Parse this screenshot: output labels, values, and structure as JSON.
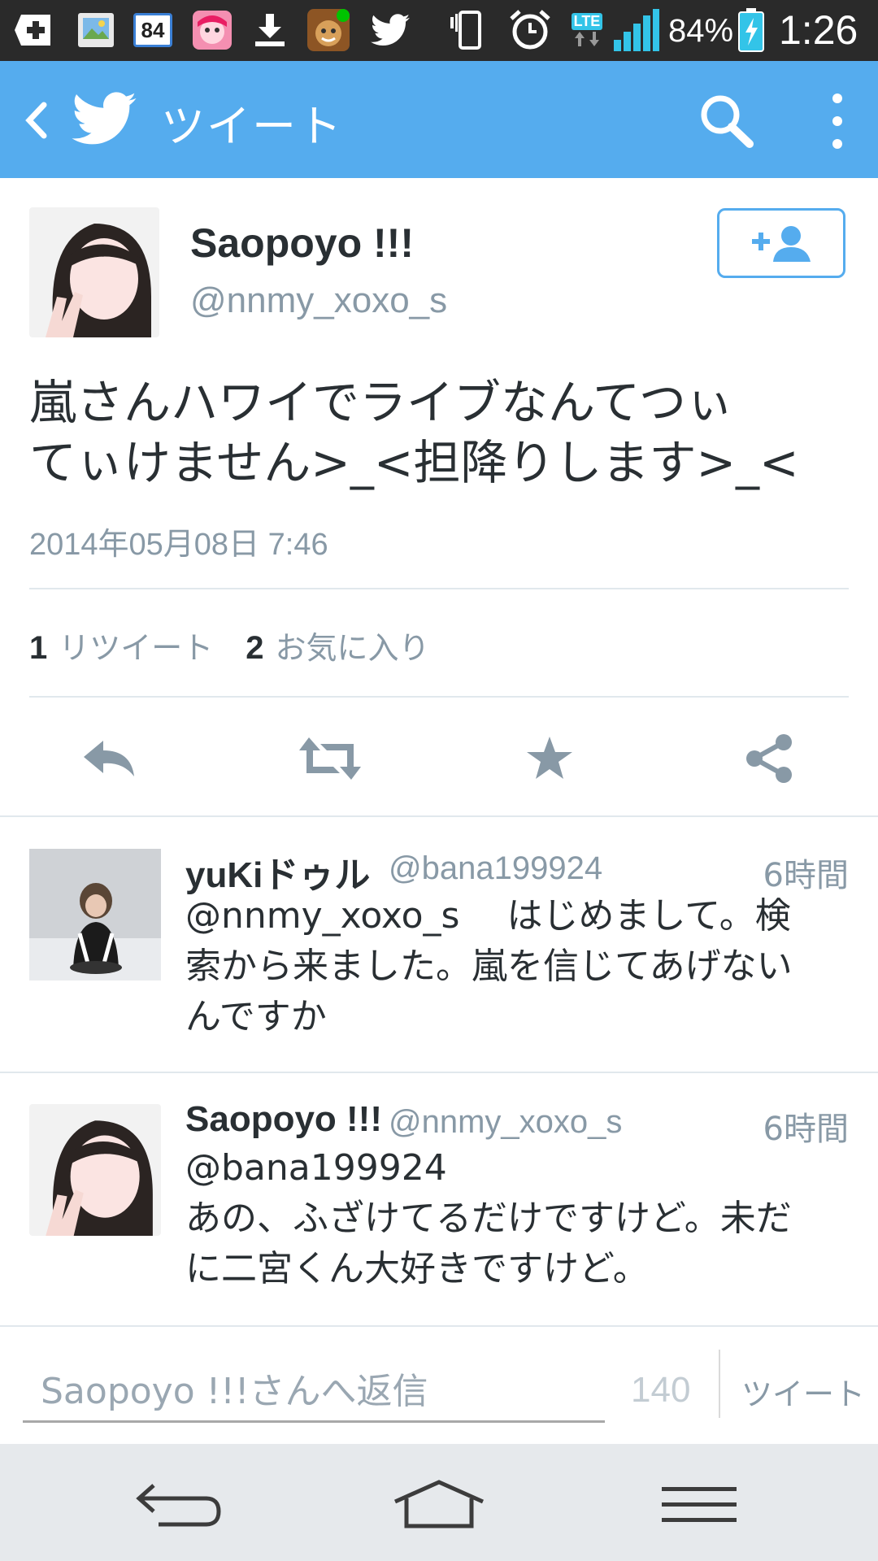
{
  "status_bar": {
    "notification_badge": "84",
    "battery": "84%",
    "time": "1:26",
    "network": "LTE",
    "icons": [
      "plus-icon",
      "gallery-icon",
      "calendar-badge-icon",
      "game-icon",
      "download-icon",
      "cookie-game-icon",
      "twitter-bird-icon",
      "vibrate-icon",
      "alarm-icon",
      "lte-icon",
      "signal-icon",
      "battery-charging-icon"
    ]
  },
  "action_bar": {
    "title": "ツイート",
    "back_icon": "back-chevron-icon",
    "logo_icon": "twitter-bird-icon",
    "search_icon": "search-icon",
    "overflow_icon": "overflow-menu-icon"
  },
  "tweet": {
    "author_name": "Saopoyo !!!",
    "author_handle": "@nnmy_xoxo_s",
    "text_line1": "嵐さんハワイでライブなんてつぃ",
    "text_line2": "てぃけません>_<担降りします>_<",
    "date": "2014年05月08日 7:46",
    "retweet_count": "1",
    "retweet_label": "リツイート",
    "favorite_count": "2",
    "favorite_label": "お気に入り",
    "actions": [
      "reply-icon",
      "retweet-icon",
      "favorite-star-icon",
      "share-icon"
    ]
  },
  "replies": [
    {
      "name": "yuKiドゥル",
      "handle": "@bana199924",
      "time": "6時間",
      "line1": "@nnmy_xoxo_s　 はじめまして。検",
      "line2": "索から来ました。嵐を信じてあげない",
      "line3": "んですか"
    },
    {
      "name": "Saopoyo !!!",
      "handle": "@nnmy_xoxo_s",
      "time": "6時間",
      "line1": "@bana199924",
      "line2": "あの、ふざけてるだけですけど。未だ",
      "line3": "に二宮くん大好きですけど。"
    }
  ],
  "compose": {
    "placeholder": "Saopoyo !!!さんへ返信",
    "char_count": "140",
    "tweet_button": "ツイート"
  },
  "nav_bar": {
    "icons": [
      "nav-back-icon",
      "nav-home-icon",
      "nav-menu-icon"
    ]
  },
  "colors": {
    "twitter_blue": "#55acee",
    "text_primary": "#292f33",
    "text_secondary": "#8899a6",
    "divider": "#e1e8ed",
    "status_bar": "#2a2a2a",
    "nav_bar": "#e6e9ec"
  }
}
